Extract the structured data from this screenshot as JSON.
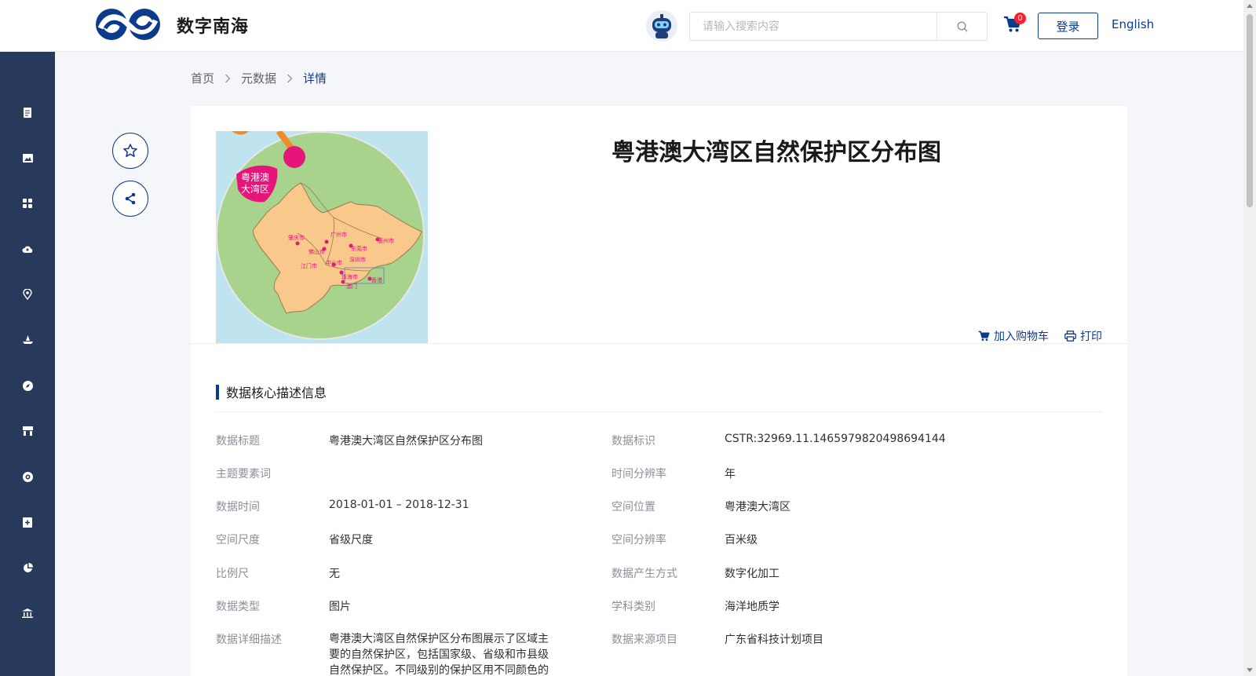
{
  "header": {
    "site_name": "数字南海",
    "search_placeholder": "请输入搜索内容",
    "cart_count": "0",
    "login_label": "登录",
    "lang_label": "English"
  },
  "sidebar": {
    "items": [
      "document-icon",
      "image-icon",
      "grid-icon",
      "cloud-upload-icon",
      "location-pin-icon",
      "ship-icon",
      "compass-icon",
      "store-icon",
      "globe-icon",
      "add-box-icon",
      "pie-chart-icon",
      "museum-icon"
    ]
  },
  "breadcrumb": {
    "home": "首页",
    "metadata": "元数据",
    "current": "详情"
  },
  "map_thumbnail": {
    "badge": [
      "粤港澳",
      "大湾区"
    ],
    "cities": [
      "肇庆市",
      "广州市",
      "惠州市",
      "佛山市",
      "东莞市",
      "江门市",
      "中山市",
      "深圳市",
      "珠海市",
      "香港",
      "澳门"
    ]
  },
  "detail": {
    "title": "粤港澳大湾区自然保护区分布图",
    "add_cart_label": "加入购物车",
    "print_label": "打印",
    "section_title": "数据核心描述信息",
    "rows": [
      {
        "k1": "数据标题",
        "v1": "粤港澳大湾区自然保护区分布图",
        "k2": "数据标识",
        "v2": "CSTR:32969.11.1465979820498694144"
      },
      {
        "k1": "主题要素词",
        "v1": "",
        "k2": "时间分辨率",
        "v2": "年"
      },
      {
        "k1": "数据时间",
        "v1": "2018-01-01 – 2018-12-31",
        "k2": "空间位置",
        "v2": "粤港澳大湾区"
      },
      {
        "k1": "空间尺度",
        "v1": "省级尺度",
        "k2": "空间分辨率",
        "v2": "百米级"
      },
      {
        "k1": "比例尺",
        "v1": "无",
        "k2": "数据产生方式",
        "v2": "数字化加工"
      },
      {
        "k1": "数据类型",
        "v1": "图片",
        "k2": "学科类别",
        "v2": "海洋地质学"
      },
      {
        "k1": "数据详细描述",
        "v1": "粤港澳大湾区自然保护区分布图展示了区域主要的自然保护区，包括国家级、省级和市县级自然保护区。不同级别的保护区用不同颜色的",
        "k2": "数据来源项目",
        "v2": "广东省科技计划项目"
      }
    ]
  },
  "colors": {
    "brand": "#0d3b8c",
    "sidebar_bg": "#283a5c",
    "badge_red": "#f5222d",
    "map_land": "#f8c98a",
    "map_green": "#a8d38c",
    "map_sea": "#bfe3ef",
    "map_pink": "#e5157a"
  }
}
